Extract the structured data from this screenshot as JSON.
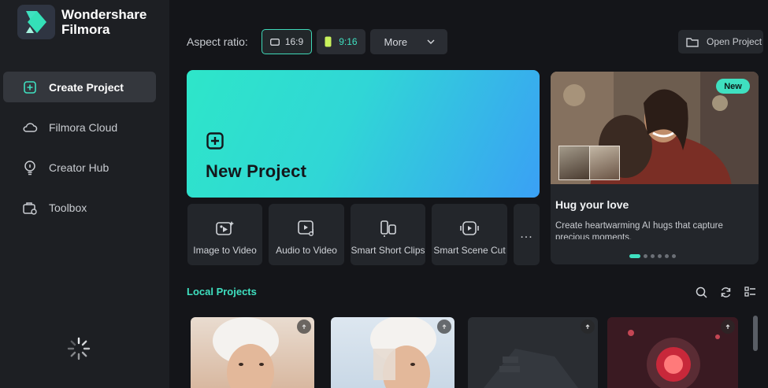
{
  "app": {
    "name_line1": "Wondershare",
    "name_line2": "Filmora"
  },
  "sidebar": {
    "items": [
      {
        "label": "Create Project",
        "icon": "plus-square-icon",
        "active": true
      },
      {
        "label": "Filmora Cloud",
        "icon": "cloud-icon",
        "active": false
      },
      {
        "label": "Creator Hub",
        "icon": "lightbulb-icon",
        "active": false
      },
      {
        "label": "Toolbox",
        "icon": "toolbox-icon",
        "active": false
      }
    ]
  },
  "topbar": {
    "aspect_label": "Aspect ratio:",
    "ratio_169": "16:9",
    "ratio_916": "9:16",
    "more_label": "More",
    "open_project_label": "Open Project"
  },
  "new_project": {
    "label": "New Project"
  },
  "tools": [
    {
      "label": "Image to Video",
      "icon": "image-to-video-icon"
    },
    {
      "label": "Audio to Video",
      "icon": "audio-to-video-icon"
    },
    {
      "label": "Smart Short Clips",
      "icon": "smart-short-clips-icon"
    },
    {
      "label": "Smart Scene Cut",
      "icon": "smart-scene-cut-icon"
    }
  ],
  "more_tools_label": "...",
  "promo": {
    "badge": "New",
    "title": "Hug your love",
    "description": "Create heartwarming AI hugs that capture precious moments.",
    "slides": 6,
    "active_slide": 1
  },
  "local_projects": {
    "title": "Local Projects",
    "icons": [
      "search-icon",
      "refresh-icon",
      "list-view-icon"
    ],
    "count_visible": 4
  },
  "colors": {
    "accent": "#3fe0c0",
    "background": "#141519",
    "sidebar": "#1d1f23"
  }
}
